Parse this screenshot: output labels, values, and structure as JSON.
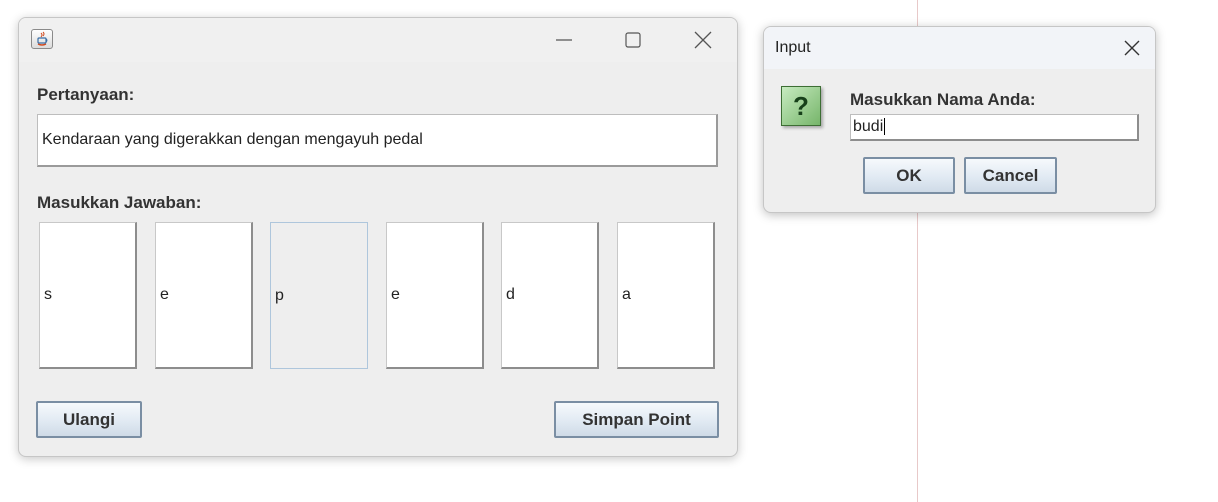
{
  "main_window": {
    "question_label": "Pertanyaan:",
    "question_text": "Kendaraan yang digerakkan dengan mengayuh pedal",
    "answer_label": "Masukkan Jawaban:",
    "letters": [
      "s",
      "e",
      "p",
      "e",
      "d",
      "a"
    ],
    "selected_letter_index": 2,
    "reset_button": "Ulangi",
    "save_button": "Simpan Point",
    "controls": {
      "minimize_icon": "minimize-icon",
      "maximize_icon": "maximize-icon",
      "close_icon": "close-icon"
    }
  },
  "dialog": {
    "title": "Input",
    "prompt": "Masukkan Nama Anda:",
    "input_value": "budi",
    "ok_button": "OK",
    "cancel_button": "Cancel",
    "icon": "question-icon",
    "icon_glyph": "?"
  },
  "colors": {
    "window_bg": "#eeeeee",
    "button_border": "#7a8ea3",
    "question_icon": "#76b56a"
  }
}
